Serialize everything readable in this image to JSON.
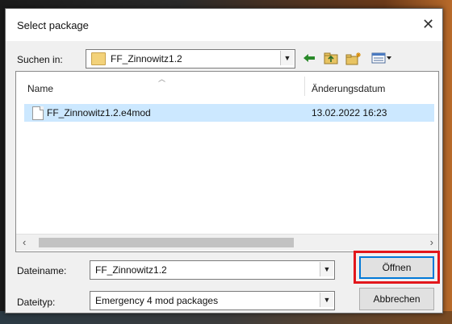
{
  "dialog": {
    "title": "Select package",
    "close_glyph": "✕"
  },
  "look_in": {
    "label": "Suchen in:",
    "value": "FF_Zinnowitz1.2"
  },
  "toolbar": {
    "icons": [
      "back-arrow-icon",
      "up-folder-icon",
      "new-folder-icon",
      "view-menu-icon"
    ],
    "colors": {
      "back": "#2a8a2a",
      "folder": "#d9b04a"
    }
  },
  "file_list": {
    "columns": [
      "Name",
      "Änderungsdatum"
    ],
    "rows": [
      {
        "name": "FF_Zinnowitz1.2.e4mod",
        "modified": "13.02.2022 16:23",
        "selected": true
      }
    ]
  },
  "filename": {
    "label": "Dateiname:",
    "value": "FF_Zinnowitz1.2"
  },
  "filetype": {
    "label": "Dateityp:",
    "value": "Emergency 4 mod packages"
  },
  "buttons": {
    "open": "Öffnen",
    "cancel": "Abbrechen"
  },
  "highlight_color": "#e2161b",
  "selection_color": "#cce8ff"
}
